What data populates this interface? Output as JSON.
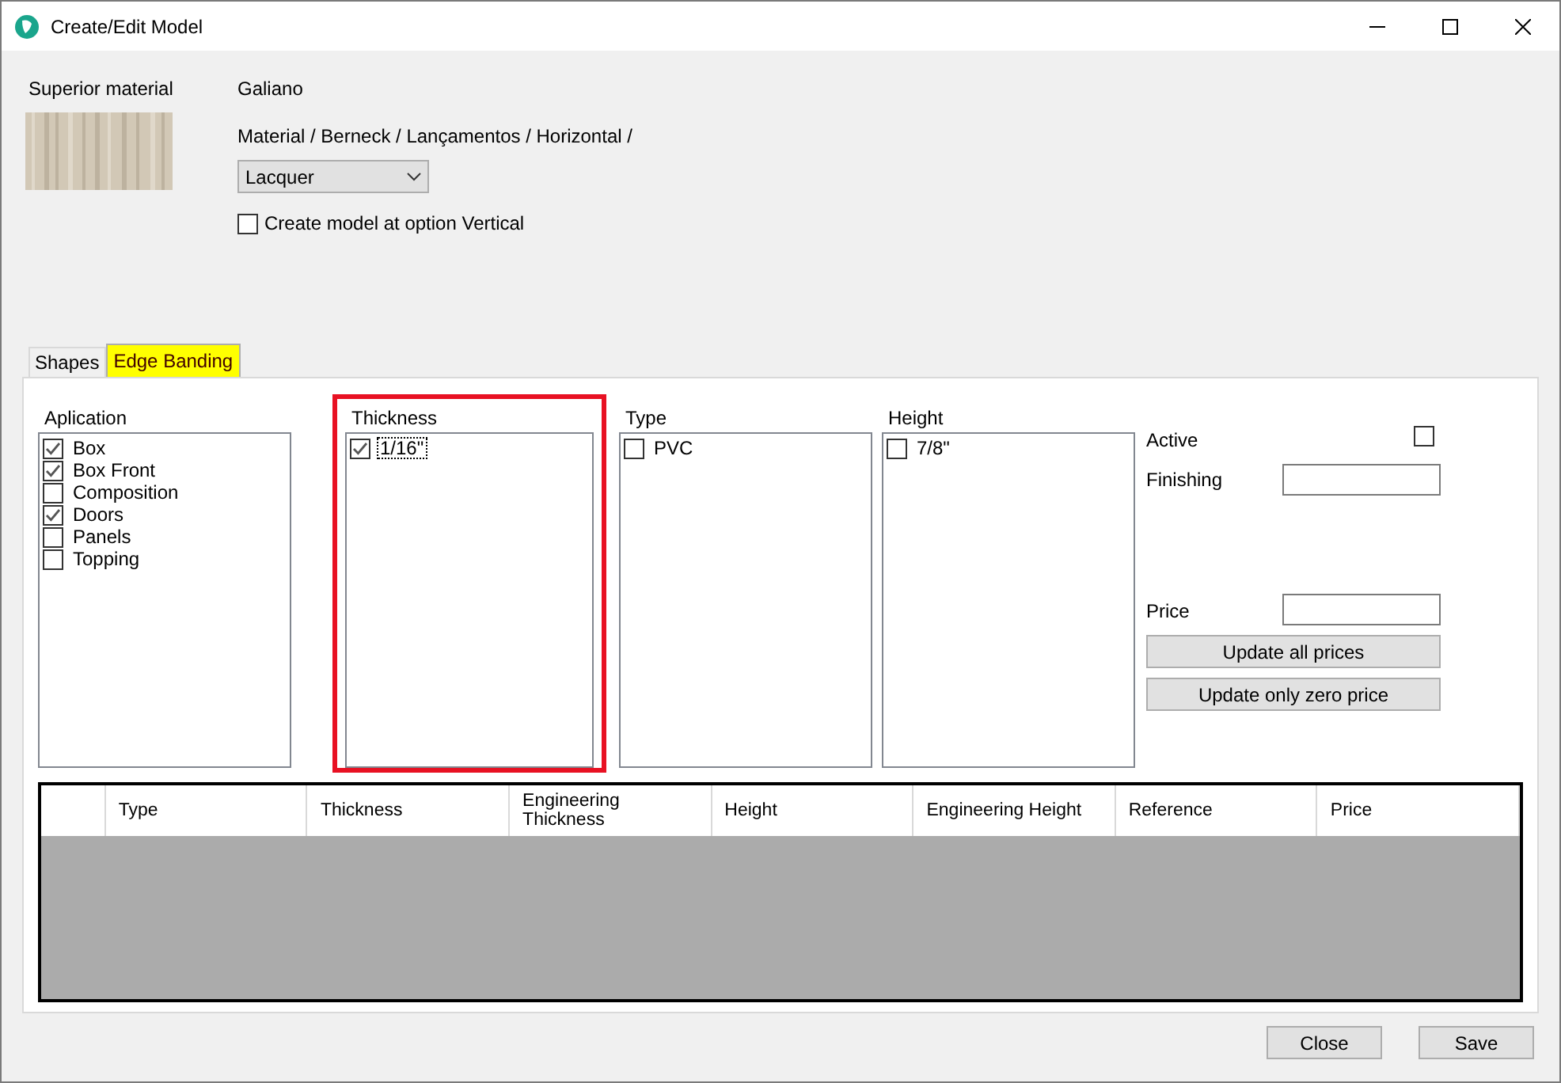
{
  "window": {
    "title": "Create/Edit Model"
  },
  "material": {
    "label": "Superior material",
    "name": "Galiano",
    "path": "Material / Berneck / Lançamentos / Horizontal /",
    "finish": "Lacquer",
    "vertical": {
      "label": "Create model at option Vertical",
      "checked": false
    }
  },
  "tabs": [
    {
      "label": "Shapes",
      "selected": false
    },
    {
      "label": "Edge Banding",
      "selected": true
    }
  ],
  "lists": [
    {
      "title": "Aplication",
      "highlighted": false,
      "items": [
        {
          "label": "Box",
          "checked": true,
          "focused": false
        },
        {
          "label": "Box Front",
          "checked": true,
          "focused": false
        },
        {
          "label": "Composition",
          "checked": false,
          "focused": false
        },
        {
          "label": "Doors",
          "checked": true,
          "focused": false
        },
        {
          "label": "Panels",
          "checked": false,
          "focused": false
        },
        {
          "label": "Topping",
          "checked": false,
          "focused": false
        }
      ]
    },
    {
      "title": "Thickness",
      "highlighted": true,
      "items": [
        {
          "label": "1/16\"",
          "checked": true,
          "focused": true
        }
      ]
    },
    {
      "title": "Type",
      "highlighted": false,
      "items": [
        {
          "label": "PVC",
          "checked": false,
          "focused": false
        }
      ]
    },
    {
      "title": "Height",
      "highlighted": false,
      "items": [
        {
          "label": "7/8\"",
          "checked": false,
          "focused": false
        }
      ]
    }
  ],
  "active": {
    "label": "Active",
    "checked": false
  },
  "finishing": {
    "label": "Finishing"
  },
  "price": {
    "label": "Price"
  },
  "update_buttons": [
    "Update all prices",
    "Update only zero price"
  ],
  "table": {
    "columns": [
      "Type",
      "Thickness",
      "Engineering Thickness",
      "Height",
      "Engineering Height",
      "Reference",
      "Price"
    ]
  },
  "footer_buttons": [
    "Close",
    "Save"
  ]
}
